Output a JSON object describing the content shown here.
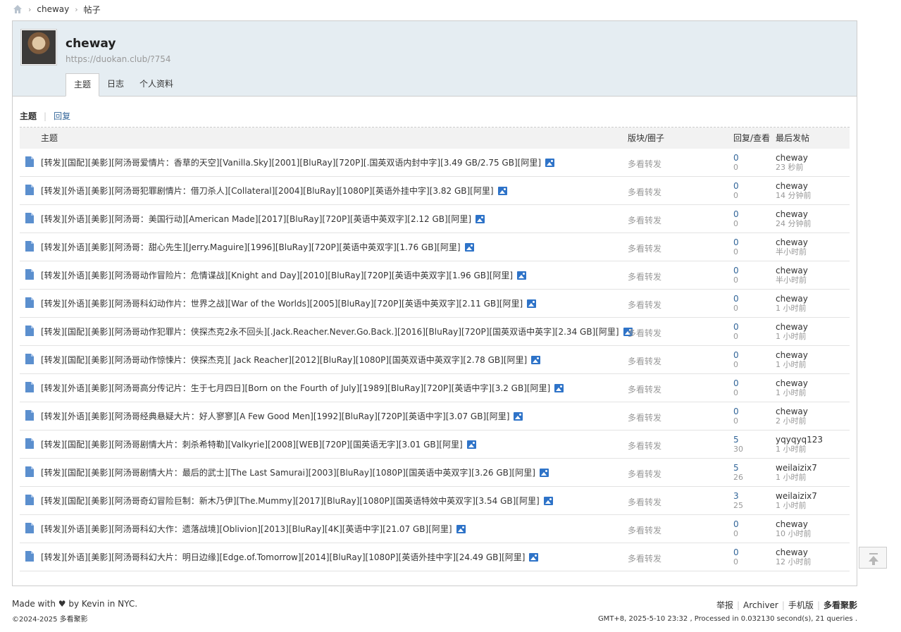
{
  "breadcrumb": {
    "items": [
      "cheway",
      "帖子"
    ]
  },
  "profile": {
    "username": "cheway",
    "url": "https://duokan.club/?754",
    "tabs": [
      "主题",
      "日志",
      "个人资料"
    ]
  },
  "subtabs": {
    "active": "主题",
    "other": "回复"
  },
  "table": {
    "headers": {
      "title": "主题",
      "forum": "版块/圈子",
      "counts": "回复/查看",
      "last": "最后发帖"
    },
    "rows": [
      {
        "title": "[转发][国配][美影][阿汤哥爱情片：香草的天空][Vanilla.Sky][2001][BluRay][720P][.国英双语内封中字][3.49 GB/2.75 GB][阿里]",
        "forum": "多看转发",
        "replies": "0",
        "views": "0",
        "user": "cheway",
        "time": "23 秒前"
      },
      {
        "title": "[转发][外语][美影][阿汤哥犯罪剧情片：借刀杀人][Collateral][2004][BluRay][1080P][英语外挂中字][3.82 GB][阿里]",
        "forum": "多看转发",
        "replies": "0",
        "views": "0",
        "user": "cheway",
        "time": "14 分钟前"
      },
      {
        "title": "[转发][外语][美影][阿汤哥：美国行动][American Made][2017][BluRay][720P][英语中英双字][2.12 GB][阿里]",
        "forum": "多看转发",
        "replies": "0",
        "views": "0",
        "user": "cheway",
        "time": "24 分钟前"
      },
      {
        "title": "[转发][外语][美影][阿汤哥：甜心先生][Jerry.Maguire][1996][BluRay][720P][英语中英双字][1.76 GB][阿里]",
        "forum": "多看转发",
        "replies": "0",
        "views": "0",
        "user": "cheway",
        "time": "半小时前"
      },
      {
        "title": "[转发][外语][美影][阿汤哥动作冒险片：危情谍战][Knight and Day][2010][BluRay][720P][英语中英双字][1.96 GB][阿里]",
        "forum": "多看转发",
        "replies": "0",
        "views": "0",
        "user": "cheway",
        "time": "半小时前"
      },
      {
        "title": "[转发][外语][美影][阿汤哥科幻动作片：世界之战][War of the Worlds][2005][BluRay][720P][英语中英双字][2.11 GB][阿里]",
        "forum": "多看转发",
        "replies": "0",
        "views": "0",
        "user": "cheway",
        "time": "1 小时前"
      },
      {
        "title": "[转发][国配][美影][阿汤哥动作犯罪片：侠探杰克2永不回头][.Jack.Reacher.Never.Go.Back.][2016][BluRay][720P][国英双语中英字][2.34 GB][阿里]",
        "forum": "多看转发",
        "replies": "0",
        "views": "0",
        "user": "cheway",
        "time": "1 小时前"
      },
      {
        "title": "[转发][国配][美影][阿汤哥动作惊悚片：侠探杰克][ Jack Reacher][2012][BluRay][1080P][国英双语中英双字][2.78 GB][阿里]",
        "forum": "多看转发",
        "replies": "0",
        "views": "0",
        "user": "cheway",
        "time": "1 小时前"
      },
      {
        "title": "[转发][外语][美影][阿汤哥高分传记片：生于七月四日][Born on the Fourth of July][1989][BluRay][720P][英语中字][3.2 GB][阿里]",
        "forum": "多看转发",
        "replies": "0",
        "views": "0",
        "user": "cheway",
        "time": "1 小时前"
      },
      {
        "title": "[转发][外语][美影][阿汤哥经典悬疑大片：好人寥寥][A Few Good Men][1992][BluRay][720P][英语中字][3.07 GB][阿里]",
        "forum": "多看转发",
        "replies": "0",
        "views": "0",
        "user": "cheway",
        "time": "2 小时前"
      },
      {
        "title": "[转发][国配][美影][阿汤哥剧情大片：刺杀希特勒][Valkyrie][2008][WEB][720P][国英语无字][3.01 GB][阿里]",
        "forum": "多看转发",
        "replies": "5",
        "views": "30",
        "user": "yqyqyq123",
        "time": "1 小时前"
      },
      {
        "title": "[转发][国配][美影][阿汤哥剧情大片：最后的武士][The Last Samurai][2003][BluRay][1080P][国英语中英双字][3.26 GB][阿里]",
        "forum": "多看转发",
        "replies": "5",
        "views": "26",
        "user": "weilaizix7",
        "time": "1 小时前"
      },
      {
        "title": "[转发][国配][美影][阿汤哥奇幻冒险巨制：新木乃伊][The.Mummy][2017][BluRay][1080P][国英语特效中英双字][3.54 GB][阿里]",
        "forum": "多看转发",
        "replies": "3",
        "views": "25",
        "user": "weilaizix7",
        "time": "1 小时前"
      },
      {
        "title": "[转发][外语][美影][阿汤哥科幻大作：遗落战境][Oblivion][2013][BluRay][4K][英语中字][21.07 GB][阿里]",
        "forum": "多看转发",
        "replies": "0",
        "views": "0",
        "user": "cheway",
        "time": "10 小时前"
      },
      {
        "title": "[转发][外语][美影][阿汤哥科幻大片：明日边缘][Edge.of.Tomorrow][2014][BluRay][1080P][英语外挂中字][24.49 GB][阿里]",
        "forum": "多看转发",
        "replies": "0",
        "views": "0",
        "user": "cheway",
        "time": "12 小时前"
      }
    ]
  },
  "footer": {
    "made_with": "Made with ♥ by Kevin in NYC.",
    "copyright": "©2024-2025 多看聚影",
    "links": [
      "举报",
      "Archiver",
      "手机版",
      "多看聚影"
    ],
    "info": "GMT+8, 2025-5-10 23:32 , Processed in 0.032130 second(s), 21 queries ."
  }
}
